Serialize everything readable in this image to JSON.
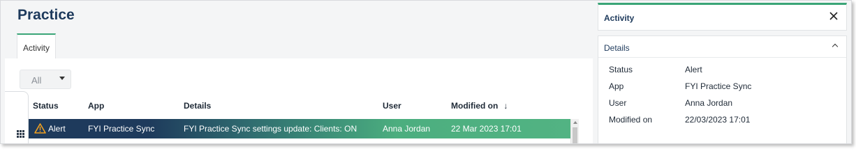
{
  "page": {
    "title": "Practice"
  },
  "tabs": [
    {
      "label": "Activity",
      "active": true
    }
  ],
  "filter": {
    "value": "All"
  },
  "table": {
    "columns": [
      {
        "label": "Status"
      },
      {
        "label": "App"
      },
      {
        "label": "Details"
      },
      {
        "label": "User"
      },
      {
        "label": "Modified on",
        "sort": "descending"
      }
    ],
    "rows": [
      {
        "status": "Alert",
        "status_icon": "warning-triangle-icon",
        "app": "FYI Practice Sync",
        "details": "FYI Practice Sync settings update: Clients: ON",
        "user": "Anna Jordan",
        "modified_on": "22 Mar 2023 17:01",
        "selected": true
      }
    ]
  },
  "side_panel": {
    "title": "Activity",
    "section_title": "Details",
    "fields": [
      {
        "label": "Status",
        "value": "Alert"
      },
      {
        "label": "App",
        "value": "FYI Practice Sync"
      },
      {
        "label": "User",
        "value": "Anna Jordan"
      },
      {
        "label": "Modified on",
        "value": "22/03/2023 17:01"
      }
    ]
  },
  "colors": {
    "accent": "#3aa577",
    "title": "#1e3a5c",
    "selected_row_start": "#1e3a5c",
    "selected_row_end": "#52b383",
    "warning": "#f0a020"
  },
  "icons": {
    "sort": "arrow-down-icon",
    "close": "close-icon",
    "collapse": "chevron-up-icon",
    "filter_caret": "caret-down-icon",
    "grid": "grid-icon"
  }
}
